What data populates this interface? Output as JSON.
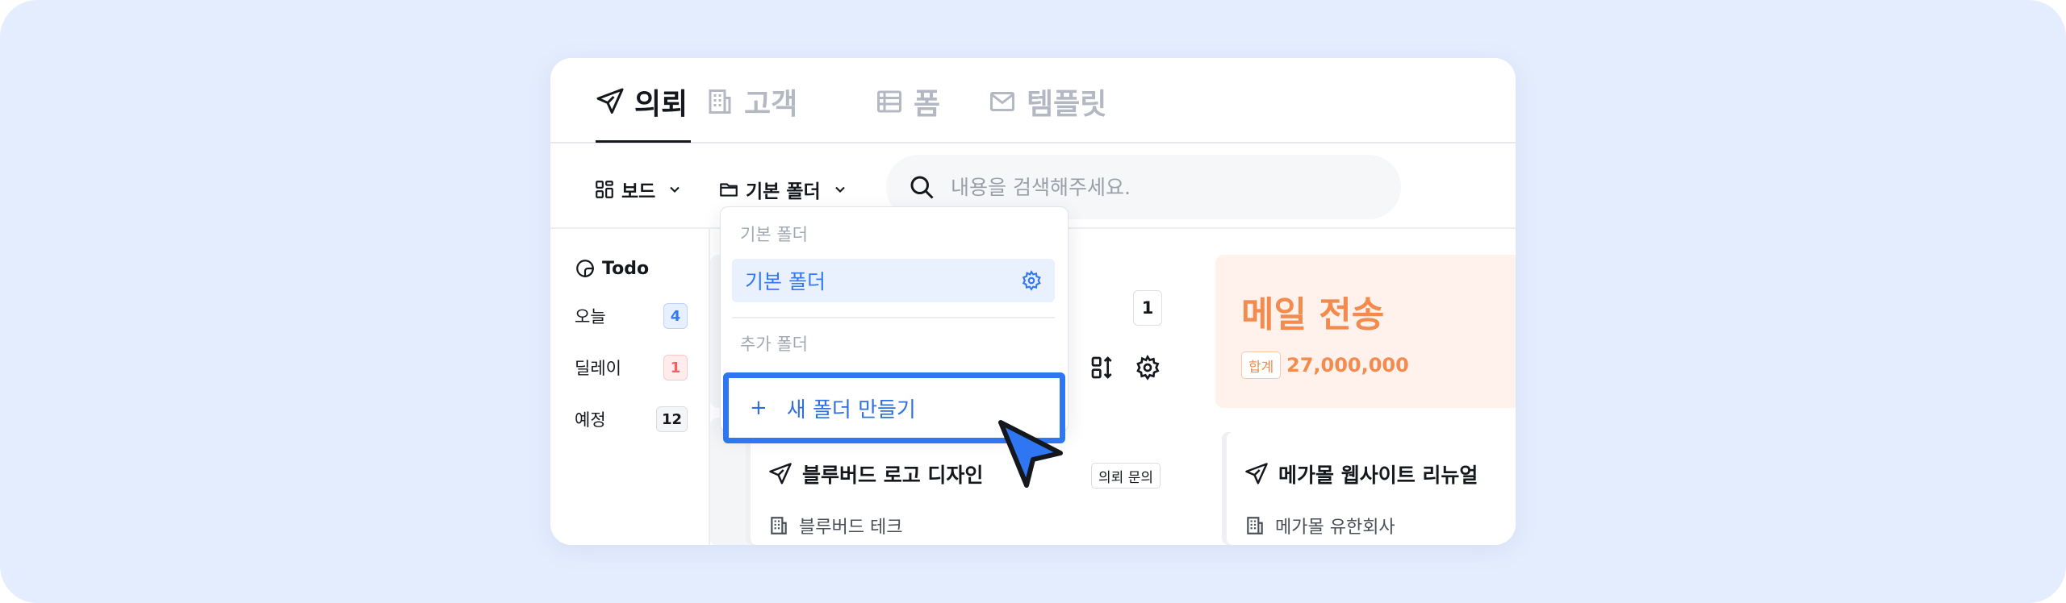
{
  "tabs": [
    {
      "label": "의뢰",
      "icon": "paper-plane-icon",
      "active": true
    },
    {
      "label": "고객",
      "icon": "building-icon",
      "active": false
    },
    {
      "label": "폼",
      "icon": "form-icon",
      "active": false
    },
    {
      "label": "템플릿",
      "icon": "mail-icon",
      "active": false
    }
  ],
  "toolbar": {
    "view_label": "보드",
    "folder_label": "기본 폴더",
    "search_placeholder": "내용을 검색해주세요."
  },
  "sidebar": {
    "title": "Todo",
    "items": [
      {
        "label": "오늘",
        "count": "4",
        "color": "#3478f6"
      },
      {
        "label": "딜레이",
        "count": "1",
        "color": "#f06161"
      },
      {
        "label": "예정",
        "count": "12",
        "color": "#14171c"
      }
    ]
  },
  "board": {
    "column1_count": "1",
    "column2_title": "메일 전송",
    "column2_sum_label": "합계",
    "column2_sum_value": "27,000,000",
    "cards": [
      {
        "title": "블루버드 로고 디자인",
        "tag": "의뢰 문의",
        "client": "블루버드 테크"
      },
      {
        "title": "메가몰 웹사이트 리뉴얼",
        "client": "메가몰 유한회사"
      }
    ]
  },
  "dropdown": {
    "section_default": "기본 폴더",
    "selected": "기본 폴더",
    "section_extra": "추가 폴더",
    "new_folder": "새 폴더 만들기",
    "plus": "+"
  },
  "colors": {
    "accent": "#2f77f2",
    "orange": "#f38a4e",
    "background": "#e4edfd"
  }
}
